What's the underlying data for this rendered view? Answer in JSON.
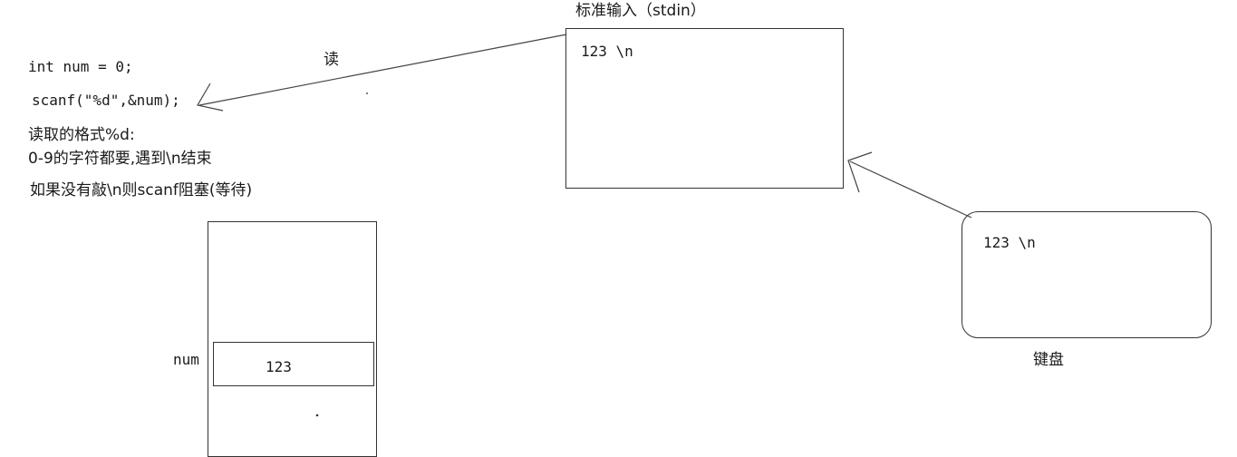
{
  "stdin": {
    "title": "标准输入（stdin）",
    "content": "123 \\n"
  },
  "read_label": "读",
  "code": {
    "line1": "int num = 0;",
    "line2": "scanf(\"%d\",&num);"
  },
  "notes": {
    "line1": "读取的格式%d:",
    "line2": "0-9的字符都要,遇到\\n结束",
    "line3": "如果没有敲\\n则scanf阻塞(等待)"
  },
  "memory": {
    "var_label": "num",
    "value": "123"
  },
  "keyboard": {
    "content": "123 \\n",
    "label": "键盘"
  },
  "colors": {
    "stroke": "#333333",
    "text": "#1a1a1a"
  }
}
